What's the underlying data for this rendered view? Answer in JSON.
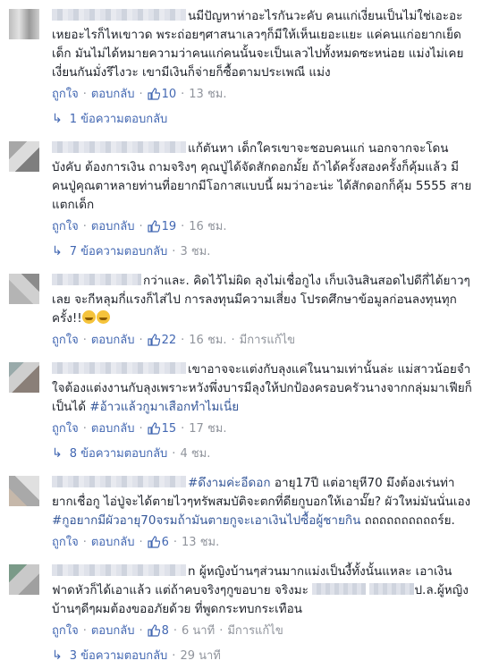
{
  "comments": [
    {
      "text": "นมีปัญหาห่าอะไรกันวะคับ คนแก่เงี่ยนเป็นไม่ใช่เอะอะเหยอะไรก็ไหเขาวด พระถ่อยๆศาสนาเลวๆก็มีให้เห็นเยอะแยะ แค่คนแก่อยากเย็ดเด็ก มันไม่ได้หมายความว่าคนแก่คนนั้นจะเป็นเลวไปทั้งหมดซะหน่อย แม่งไม่เคยเงี่ยนกันมั่งรึไงวะ เขามีเงินก็จ่ายก็ซื้อตามประเพณี แม่ง",
      "like_label": "ถูกใจ",
      "reply_label": "ตอบกลับ",
      "likes": "10",
      "time": "13 ชม.",
      "edited": "",
      "replies": "1 ข้อความตอบกลับ",
      "replies_time": ""
    },
    {
      "text": "แก้ตันหา เด็กใครเขาจะชอบคนแก่ นอกจากจะโดนบังคับ ต้องการเงิน ถามจริงๆ คุณปู่ได้จัดสักดอกมั้ย ถ้าได้ครั้งสองครั้งก็คุ้มแล้ว มีคนปู่คุณตาหลายท่านที่อยากมีโอกาสแบบนี้ ผมว่าอะน่ะ ได้สักดอกก็คุ้ม 5555 สายแตกเด็ก",
      "like_label": "ถูกใจ",
      "reply_label": "ตอบกลับ",
      "likes": "19",
      "time": "16 ชม.",
      "edited": "",
      "replies": "7 ข้อความตอบกลับ",
      "replies_time": "3 ชม."
    },
    {
      "text": "กว่าและ. คิดไว้ไม่ผิด ลุงไม่เชื่อกูไง เก็บเงินสินสอดไปดีกี่ได้ยาวๆเลย จะกีหลุมกี่แรงก็ไส่ไป การลงทุนมีความเสี่ยง โปรดศึกษาข้อมูลก่อนลงทุนทุกครั้ง!!",
      "like_label": "ถูกใจ",
      "reply_label": "ตอบกลับ",
      "likes": "22",
      "time": "16 ชม.",
      "edited": "มีการแก้ไข",
      "replies": "",
      "replies_time": ""
    },
    {
      "text": "เขาอาจจะแต่งกับลุงแค่ในนามเท่านั้นล่ะ แม่สาวน้อยจำใจต้องแต่งงานกับลุงเพราะหวังพึ่งบารมีลุงให้ปกป้องครอบครัวนางจากกลุ่มมาเฟียก็เป็นได้ ",
      "hashtag": "#อ้าวแล้วกูมาเสือกทำไมเนี่ย",
      "like_label": "ถูกใจ",
      "reply_label": "ตอบกลับ",
      "likes": "15",
      "time": "17 ชม.",
      "edited": "",
      "replies": "8 ข้อความตอบกลับ",
      "replies_time": "4 ชม."
    },
    {
      "hashtag": "#ดึงามค่ะอีดอก",
      "text": " อายุ17ปี แต่อายุหี70 มึงต้องเร่นท่ายากเชื่อกู ไอ่ปู่จะได้ตายไวๆทรัพสมบัติจะตกที่ดียกูบอกให้เอามั๊ย? ผัวใหม่มันนั่นเอง ",
      "hashtag2": "#กูอยากมีผัวอายุ70จรมถ้ามันตายกูจะเอาเงินไปซื้อผู้ชายกิน",
      "text2": " ถถถถถถถถถถร์ย.",
      "like_label": "ถูกใจ",
      "reply_label": "ตอบกลับ",
      "likes": "6",
      "time": "13 ชม.",
      "edited": "",
      "replies": "",
      "replies_time": ""
    },
    {
      "text": "n ผู้หญิงบ้านๆส่วนมากแม่งเป็นงี้ทั้งนั้นแหละ เอาเงินฟาดหัวก็ได้เอาแล้ว แต่ถ้าคบจริงๆกูขอบาย จริงมะ ",
      "text2": "ป.ล.ผู้หญิงบ้านๆดีๆผมต้องขออภัยด้วย ที่พูดกระทบกระเทือน",
      "like_label": "ถูกใจ",
      "reply_label": "ตอบกลับ",
      "likes": "8",
      "time": "6 นาที",
      "edited": "มีการแก้ไข",
      "replies": "3 ข้อความตอบกลับ",
      "replies_time": "29 นาที"
    }
  ],
  "icons": {
    "like": "thumbs-up-icon",
    "reply": "reply-arrow-icon"
  },
  "colors": {
    "link": "#4267b2",
    "meta": "#90949c",
    "hashtag": "#365899"
  }
}
